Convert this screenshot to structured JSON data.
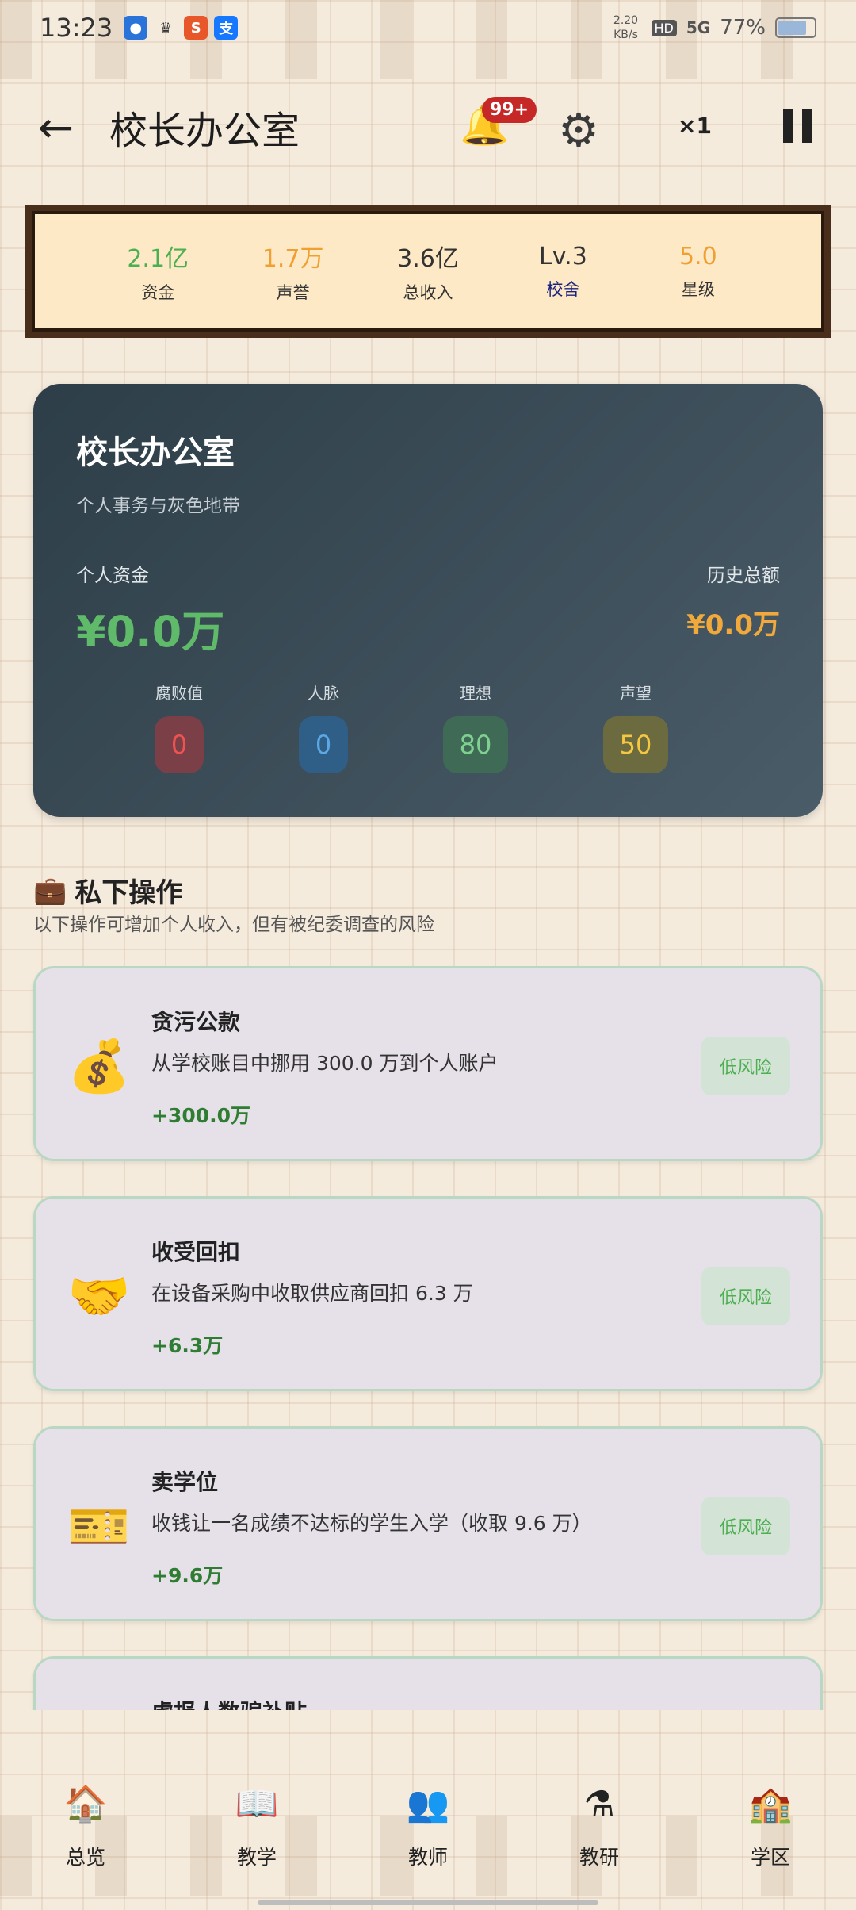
{
  "status_bar": {
    "time": "13:23",
    "net_speed": "2.20 KB/s",
    "hd": "HD",
    "signal": "5G",
    "battery": "77%"
  },
  "header": {
    "title": "校长办公室",
    "badge": "99+",
    "speed": "×1"
  },
  "resources": [
    {
      "value": "2.1亿",
      "label": "资金",
      "color": "#4caf50"
    },
    {
      "value": "1.7万",
      "label": "声誉",
      "color": "#f0a030"
    },
    {
      "value": "3.6亿",
      "label": "总收入",
      "color": "#333333"
    },
    {
      "value": "Lv.3",
      "label": "校舍",
      "color": "#333333"
    },
    {
      "value": "5.0",
      "label": "星级",
      "color": "#f0a030"
    }
  ],
  "office": {
    "title": "校长办公室",
    "subtitle": "个人事务与灰色地带",
    "fund_label": "个人资金",
    "fund_value": "¥0.0万",
    "history_label": "历史总额",
    "history_value": "¥0.0万",
    "stats": [
      {
        "label": "腐败值",
        "value": "0",
        "bg": "#7a3f47",
        "fg": "#ef5350"
      },
      {
        "label": "人脉",
        "value": "0",
        "bg": "#2f5f86",
        "fg": "#5aa8e6"
      },
      {
        "label": "理想",
        "value": "80",
        "bg": "#3f6b56",
        "fg": "#7fd18f"
      },
      {
        "label": "声望",
        "value": "50",
        "bg": "#6c6a3f",
        "fg": "#f5c842"
      }
    ]
  },
  "section": {
    "title": "私下操作",
    "description": "以下操作可增加个人收入，但有被纪委调查的风险"
  },
  "actions": [
    {
      "icon": "💰",
      "icon_name": "money-bag-icon",
      "name": "贪污公款",
      "desc": "从学校账目中挪用 300.0 万到个人账户",
      "gain": "+300.0万",
      "risk": "低风险"
    },
    {
      "icon": "🤝",
      "icon_name": "handshake-icon",
      "name": "收受回扣",
      "desc": "在设备采购中收取供应商回扣 6.3 万",
      "gain": "+6.3万",
      "risk": "低风险"
    },
    {
      "icon": "🎫",
      "icon_name": "ticket-icon",
      "name": "卖学位",
      "desc": "收钱让一名成绩不达标的学生入学（收取 9.6 万）",
      "gain": "+9.6万",
      "risk": "低风险"
    },
    {
      "icon": "",
      "icon_name": "",
      "name": "虚报人数骗补贴",
      "desc": "",
      "gain": "",
      "risk": ""
    }
  ],
  "nav": [
    {
      "icon": "🏠",
      "icon_name": "house-icon",
      "label": "总览"
    },
    {
      "icon": "📖",
      "icon_name": "book-icon",
      "label": "教学"
    },
    {
      "icon": "👥",
      "icon_name": "teachers-icon",
      "label": "教师"
    },
    {
      "icon": "⚗",
      "icon_name": "flask-icon",
      "label": "教研"
    },
    {
      "icon": "🏫",
      "icon_name": "school-icon",
      "label": "学区"
    }
  ]
}
